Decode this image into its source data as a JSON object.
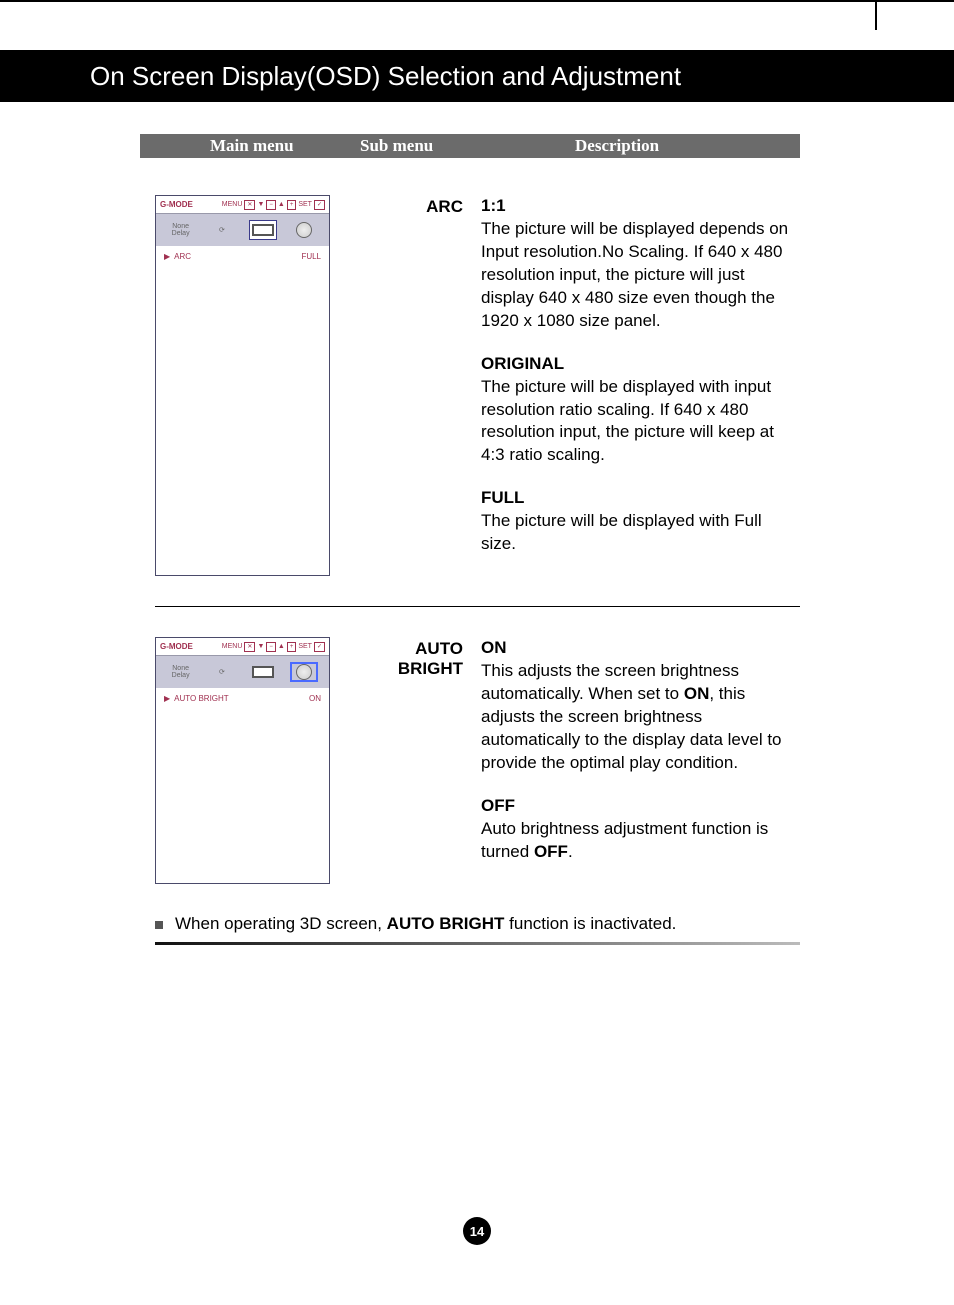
{
  "page_title": "On Screen Display(OSD) Selection and Adjustment",
  "headers": {
    "main": "Main menu",
    "sub": "Sub menu",
    "desc": "Description"
  },
  "section1": {
    "osd": {
      "title": "G-MODE",
      "menu": "MENU",
      "set": "SET",
      "status_label": "ARC",
      "status_value": "FULL"
    },
    "submenu": "ARC",
    "items": [
      {
        "title": "1:1",
        "body": "The picture will be displayed depends on Input resolution.No Scaling. If 640 x 480 resolution input, the picture will just display 640 x 480 size even though the 1920 x 1080 size panel."
      },
      {
        "title": "ORIGINAL",
        "body": "The picture will be displayed with input resolution ratio scaling. If 640 x 480 resolution input, the picture will keep at 4:3 ratio scaling."
      },
      {
        "title": "FULL",
        "body": "The picture will be displayed with Full size."
      }
    ]
  },
  "section2": {
    "osd": {
      "title": "G-MODE",
      "menu": "MENU",
      "set": "SET",
      "status_label": "AUTO BRIGHT",
      "status_value": "ON"
    },
    "submenu": "AUTO BRIGHT",
    "items": [
      {
        "title": "ON",
        "body_pre": "This adjusts the screen brightness automatically. When set to ",
        "body_bold": "ON",
        "body_post": ", this adjusts the screen brightness automatically to the display data level to provide the optimal play condition."
      },
      {
        "title": "OFF",
        "body_pre": "Auto brightness adjustment function is turned ",
        "body_bold": "OFF",
        "body_post": "."
      }
    ]
  },
  "note": {
    "pre": "When operating 3D screen, ",
    "bold": "AUTO BRIGHT",
    "post": " function is inactivated."
  },
  "page_number": "14"
}
